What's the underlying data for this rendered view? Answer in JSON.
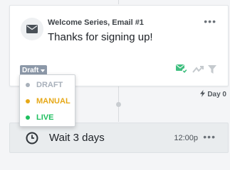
{
  "email_card": {
    "name": "Welcome Series, Email #1",
    "subject": "Thanks for signing up!",
    "status_label": "Draft",
    "more_icon": "more-horizontal-icon",
    "tool_icons": [
      "approved-check-icon",
      "split-test-icon",
      "filter-icon"
    ]
  },
  "status_dropdown": {
    "options": [
      {
        "label": "DRAFT",
        "color": "#a9b1bb"
      },
      {
        "label": "MANUAL",
        "color": "#e6a817"
      },
      {
        "label": "LIVE",
        "color": "#1fbf5f"
      }
    ]
  },
  "day_marker": {
    "label": "Day 0",
    "icon": "lightning-icon"
  },
  "wait_step": {
    "label": "Wait 3 days",
    "time": "12:00p",
    "icon": "clock-icon"
  },
  "colors": {
    "status_badge": "#8c98a8",
    "approved_green": "#3fbf7f",
    "background": "#f4f5f7"
  }
}
